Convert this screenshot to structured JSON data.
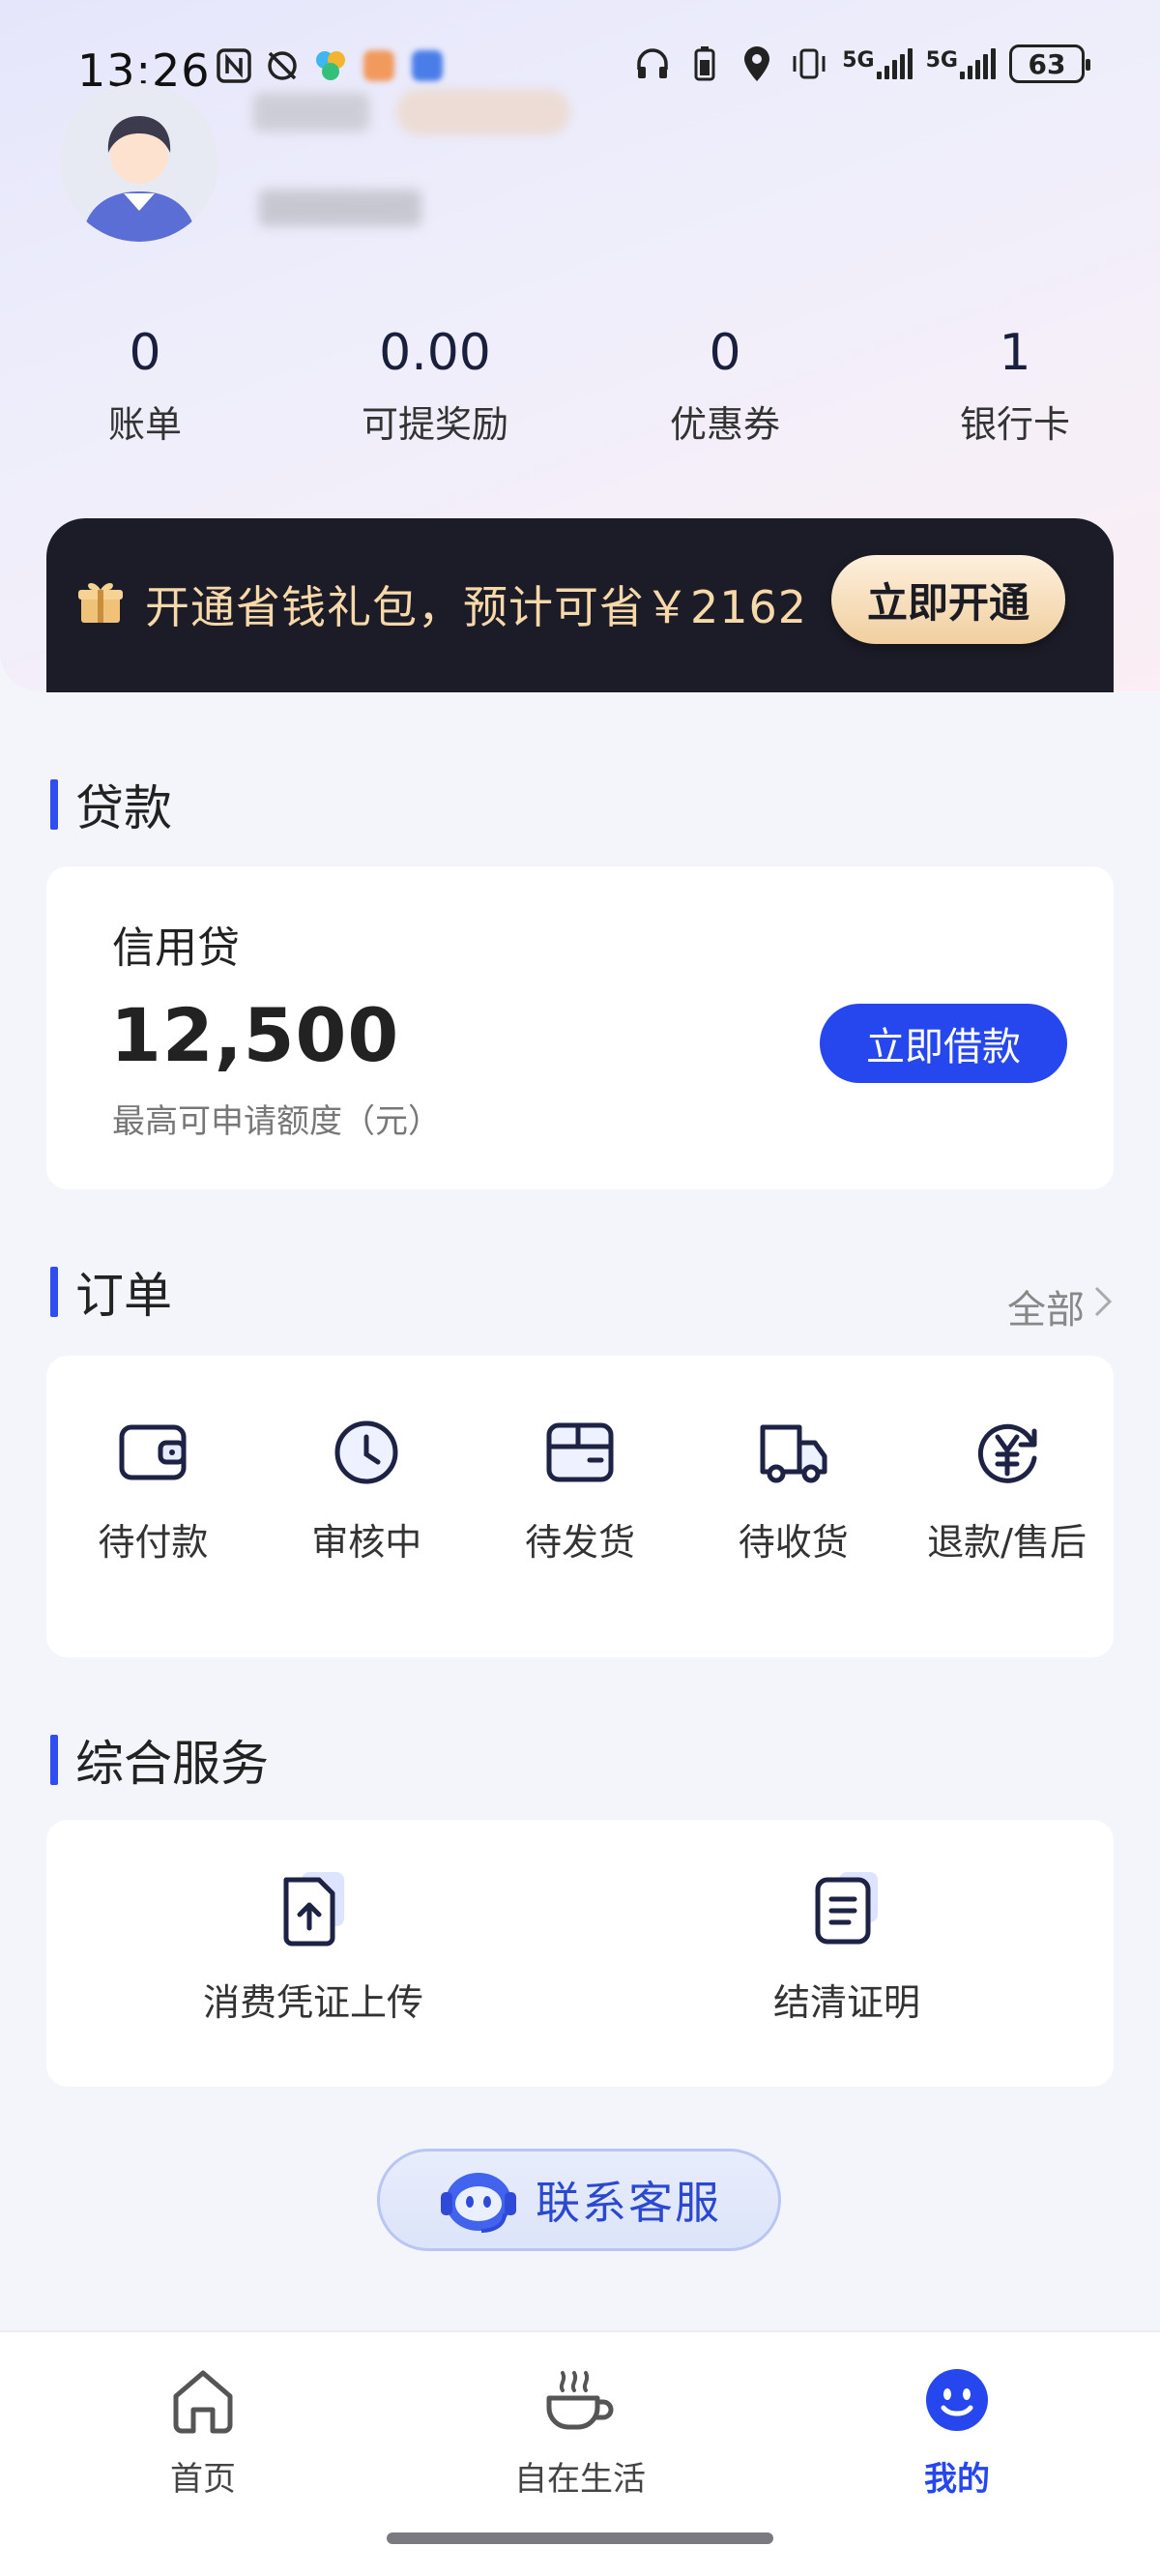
{
  "status_bar": {
    "time": "13:26",
    "battery": "63",
    "network1": "5G",
    "network2": "5G"
  },
  "stats": [
    {
      "value": "0",
      "label": "账单"
    },
    {
      "value": "0.00",
      "label": "可提奖励"
    },
    {
      "value": "0",
      "label": "优惠券"
    },
    {
      "value": "1",
      "label": "银行卡"
    }
  ],
  "promo": {
    "text": "开通省钱礼包，预计可省￥2162",
    "button": "立即开通"
  },
  "loan_section": {
    "title": "贷款",
    "product": "信用贷",
    "amount": "12,500",
    "amount_caption": "最高可申请额度（元）",
    "button": "立即借款"
  },
  "orders_section": {
    "title": "订单",
    "all_link": "全部",
    "items": [
      {
        "label": "待付款",
        "icon": "wallet-icon"
      },
      {
        "label": "审核中",
        "icon": "clock-icon"
      },
      {
        "label": "待发货",
        "icon": "package-icon"
      },
      {
        "label": "待收货",
        "icon": "truck-icon"
      },
      {
        "label": "退款/售后",
        "icon": "refund-icon"
      }
    ]
  },
  "services_section": {
    "title": "综合服务",
    "items": [
      {
        "label": "消费凭证上传",
        "icon": "upload-document-icon"
      },
      {
        "label": "结清证明",
        "icon": "certificate-document-icon"
      }
    ]
  },
  "customer_service": {
    "label": "联系客服"
  },
  "tabbar": [
    {
      "label": "首页",
      "icon": "home-icon",
      "active": false
    },
    {
      "label": "自在生活",
      "icon": "coffee-cup-icon",
      "active": false
    },
    {
      "label": "我的",
      "icon": "smiley-icon",
      "active": true
    }
  ],
  "colors": {
    "accent": "#2646ee",
    "promo_bg": "#1c1c28",
    "promo_text": "#f7d8a8",
    "page_bg": "#f3f5fa"
  }
}
